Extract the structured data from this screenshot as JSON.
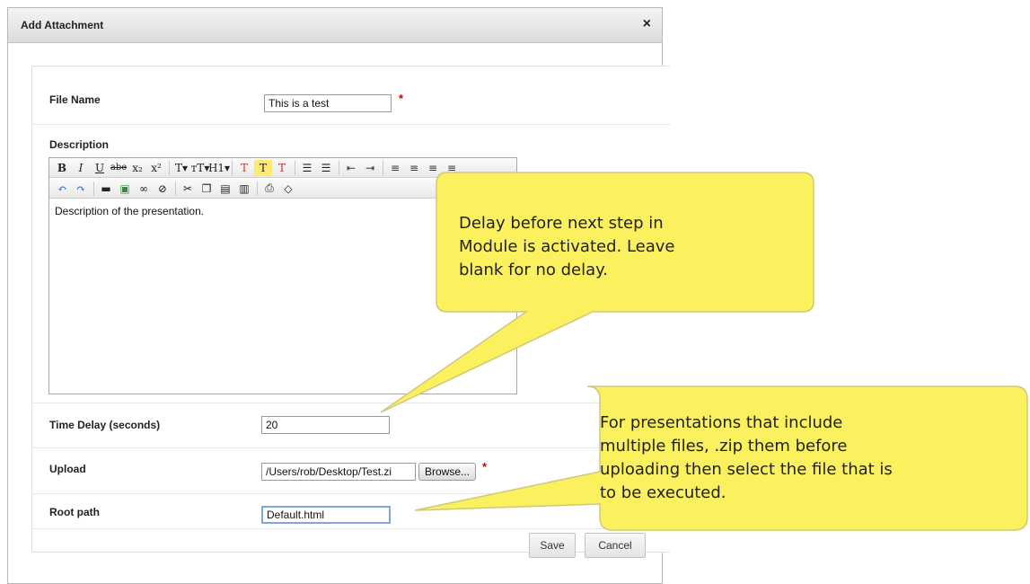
{
  "dialog": {
    "title": "Add Attachment",
    "close_glyph": "×"
  },
  "form": {
    "file_name": {
      "label": "File Name",
      "value": "This is a test",
      "required": "*"
    },
    "description": {
      "label": "Description",
      "text": "Description of the presentation."
    },
    "editor_toolbar_row1": [
      {
        "icon": "bold-icon",
        "glyph": "B"
      },
      {
        "icon": "italic-icon",
        "glyph": "I"
      },
      {
        "icon": "underline-icon",
        "glyph": "U"
      },
      {
        "icon": "strikethrough-icon",
        "glyph": "abe"
      },
      {
        "icon": "subscript-icon",
        "glyph": "x₂"
      },
      {
        "icon": "superscript-icon",
        "glyph": "x²"
      },
      {
        "icon": "font-size-icon",
        "glyph": "T▾"
      },
      {
        "icon": "font-family-icon",
        "glyph": "ᴛT▾"
      },
      {
        "icon": "heading-icon",
        "glyph": "H1▾"
      },
      {
        "icon": "text-color-icon",
        "glyph": "T"
      },
      {
        "icon": "highlight-icon",
        "glyph": "T"
      },
      {
        "icon": "remove-format-icon",
        "glyph": "T"
      },
      {
        "icon": "bulleted-list-icon",
        "glyph": "☰"
      },
      {
        "icon": "numbered-list-icon",
        "glyph": "☰"
      },
      {
        "icon": "outdent-icon",
        "glyph": "⇤"
      },
      {
        "icon": "indent-icon",
        "glyph": "⇥"
      },
      {
        "icon": "align-left-icon",
        "glyph": "≡"
      },
      {
        "icon": "align-center-icon",
        "glyph": "≡"
      },
      {
        "icon": "align-right-icon",
        "glyph": "≡"
      },
      {
        "icon": "justify-icon",
        "glyph": "≡"
      }
    ],
    "editor_toolbar_row2": [
      {
        "icon": "undo-icon",
        "glyph": "↶"
      },
      {
        "icon": "redo-icon",
        "glyph": "↷"
      },
      {
        "icon": "horizontal-rule-icon",
        "glyph": "▬"
      },
      {
        "icon": "image-icon",
        "glyph": "▣"
      },
      {
        "icon": "link-icon",
        "glyph": "∞"
      },
      {
        "icon": "unlink-icon",
        "glyph": "⊘"
      },
      {
        "icon": "cut-icon",
        "glyph": "✂"
      },
      {
        "icon": "copy-icon",
        "glyph": "❐"
      },
      {
        "icon": "paste-icon",
        "glyph": "▤"
      },
      {
        "icon": "paste-word-icon",
        "glyph": "▥"
      },
      {
        "icon": "print-icon",
        "glyph": "⎙"
      },
      {
        "icon": "source-icon",
        "glyph": "◇"
      }
    ],
    "time_delay": {
      "label": "Time Delay (seconds)",
      "value": "20"
    },
    "upload": {
      "label": "Upload",
      "value": "/Users/rob/Desktop/Test.zi",
      "browse_label": "Browse...",
      "required": "*"
    },
    "root_path": {
      "label": "Root path",
      "value": "Default.html"
    }
  },
  "buttons": {
    "save": "Save",
    "cancel": "Cancel"
  },
  "callouts": {
    "delay": {
      "lines": [
        "Delay before next step in",
        "Module is activated.  Leave",
        "blank for no delay."
      ]
    },
    "zip": {
      "lines": [
        "For presentations that include",
        "multiple files, .zip them before",
        "uploading then select the file that is",
        "to be executed."
      ]
    }
  },
  "colors": {
    "callout_fill": "#fbf05e",
    "callout_stroke": "#cfc87a",
    "required": "#cc0000"
  }
}
